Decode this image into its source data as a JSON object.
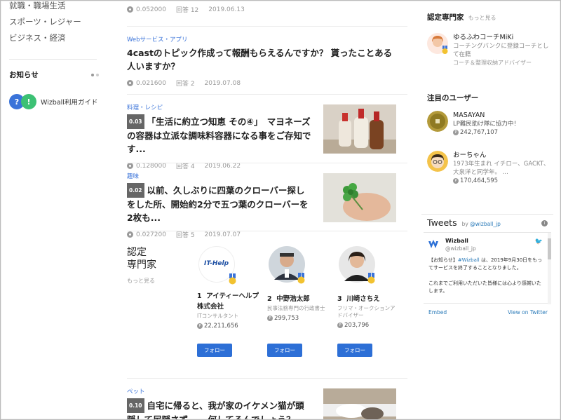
{
  "left": {
    "categories": [
      "就職・職場生活",
      "スポーツ・レジャー",
      "ビジネス・経済"
    ],
    "news_title": "お知らせ",
    "guide_icon_1": "?",
    "guide_icon_2": "!",
    "guide_label": "Wizball利用ガイド"
  },
  "articles": [
    {
      "category": "",
      "title": "",
      "badge": "",
      "value": "0.052000",
      "answers": "回答 12",
      "date": "2019.06.13"
    },
    {
      "category": "Webサービス・アプリ",
      "title": "4castのトピック作成って報酬もらえるんですか？ 貰ったことある人いますか？",
      "badge": "",
      "value": "0.021600",
      "answers": "回答 2",
      "date": "2019.07.08"
    },
    {
      "category": "料理・レシピ",
      "title": "「生活に約立つ知恵 その④」　マヨネーズの容器は立派な調味料容器になる事をご存知です...",
      "badge": "0.03",
      "value": "0.128000",
      "answers": "回答 4",
      "date": "2019.06.22"
    },
    {
      "category": "趣味",
      "title": "以前、久しぶりに四葉のクローバー探しをした所、開始約2分で五つ葉のクローバーを2枚も...",
      "badge": "0.02",
      "value": "0.027200",
      "answers": "回答 5",
      "date": "2019.07.07"
    },
    {
      "category": "ペット",
      "title": "自宅に帰ると、我が家のイケメン猫が頭隠して尻隠さず......何してるんでしょう？",
      "badge": "0.10",
      "value": "",
      "answers": "",
      "date": ""
    }
  ],
  "experts": {
    "title_line1": "認定",
    "title_line2": "専門家",
    "more": "もっと見る",
    "cards": [
      {
        "rank": "1",
        "name": "アイティーヘルプ株式会社",
        "desc": "ITコンサルタント",
        "points": "22,211,656",
        "follow": "フォロー",
        "logo_text": "IT-Help"
      },
      {
        "rank": "2",
        "name": "中野浩太郎",
        "desc": "民事法務専門の行政書士",
        "points": "299,753",
        "follow": "フォロー"
      },
      {
        "rank": "3",
        "name": "川崎さちえ",
        "desc": "フリマ・オークションアドバイザー",
        "points": "203,796",
        "follow": "フォロー"
      }
    ]
  },
  "right": {
    "experts_title": "認定専門家",
    "experts_more": "もっと見る",
    "expert_user": {
      "name": "ゆるふわコーチMiKi",
      "desc": "コーチングバンクに登録コーチとして在籍",
      "sub": "コーチ＆整理収納アドバイザー"
    },
    "featured_title": "注目のユーザー",
    "users": [
      {
        "name": "MASAYAN",
        "desc": "LP難民助け隊に協力中！",
        "points": "242,767,107"
      },
      {
        "name": "おーちゃん",
        "desc": "1973年生まれ イチロー、GACKT、大泉洋と同学年。 ...",
        "points": "170,464,595"
      }
    ]
  },
  "tweets": {
    "title": "Tweets",
    "by": "by",
    "handle_link": "@wizball_jp",
    "account_name": "Wizball",
    "account_handle": "@wizball_jp",
    "text_1": "【お知らせ】",
    "hashtag": "#Wizball",
    "text_2": " は、2019年9月30日をもってサービスを終了することとなりました。",
    "text_3": "これまでご利用いただいた皆様には心より感謝いたします。",
    "embed": "Embed",
    "view": "View on Twitter",
    "info": "i",
    "bird": "🐦"
  },
  "colors": {
    "accent": "#2d6fd6",
    "link": "#3a73d9",
    "twitter": "#2b7bb9"
  }
}
